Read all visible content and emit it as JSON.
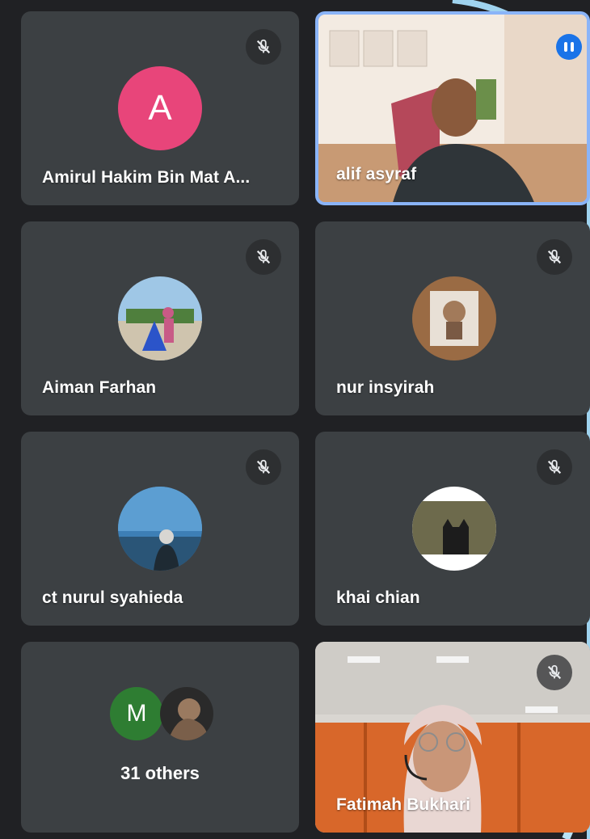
{
  "participants": [
    {
      "name": "Amirul Hakim Bin Mat A...",
      "avatar_letter": "A",
      "avatar_color": "#e8457a",
      "muted": true
    },
    {
      "name": "alif asyraf",
      "video": true,
      "active_speaker": true
    },
    {
      "name": "Aiman Farhan",
      "avatar_photo": true,
      "muted": true
    },
    {
      "name": "nur insyirah",
      "avatar_photo": true,
      "muted": true
    },
    {
      "name": "ct nurul syahieda",
      "avatar_photo": true,
      "muted": true
    },
    {
      "name": "khai chian",
      "avatar_photo": true,
      "muted": true
    },
    {
      "name": "Fatimah Bukhari",
      "video": true,
      "muted": true
    }
  ],
  "others_tile": {
    "label": "31 others",
    "avatar_letter": "M",
    "avatar_color": "#2e7d32"
  },
  "icons": {
    "mute": "mic-off-icon",
    "speaking": "audio-level-icon"
  },
  "colors": {
    "tile_bg": "#3c4043",
    "page_bg": "#202124",
    "speaker_border": "#8ab4f8"
  }
}
